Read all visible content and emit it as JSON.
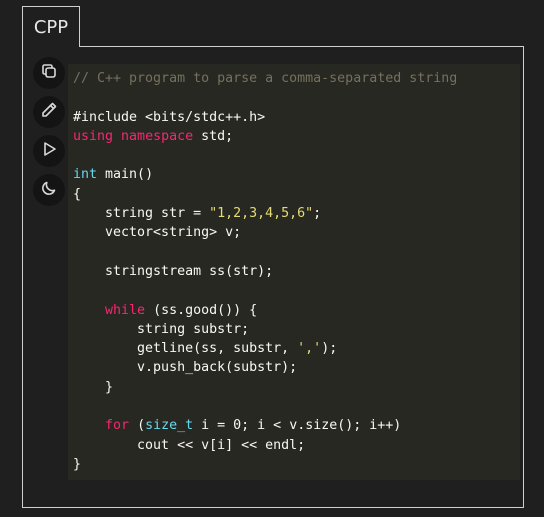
{
  "tab": {
    "label": "CPP"
  },
  "toolbar": {
    "icons": [
      {
        "name": "copy-icon"
      },
      {
        "name": "edit-icon"
      },
      {
        "name": "run-icon"
      },
      {
        "name": "dark-mode-icon"
      }
    ]
  },
  "colors": {
    "background": "#1f1f1f",
    "code_background": "#272822",
    "comment": "#75715e",
    "keyword": "#f92672",
    "type": "#66d9ef",
    "string": "#e6db74",
    "text": "#f8f8f2"
  },
  "code": {
    "language": "CPP",
    "lines": [
      [
        {
          "t": "comment",
          "v": "// C++ program to parse a comma-separated string"
        }
      ],
      [],
      [
        {
          "t": "plain",
          "v": "#include <bits/stdc++.h>"
        }
      ],
      [
        {
          "t": "keyword",
          "v": "using"
        },
        {
          "t": "plain",
          "v": " "
        },
        {
          "t": "keyword",
          "v": "namespace"
        },
        {
          "t": "plain",
          "v": " std;"
        }
      ],
      [],
      [
        {
          "t": "type",
          "v": "int"
        },
        {
          "t": "plain",
          "v": " main()"
        }
      ],
      [
        {
          "t": "plain",
          "v": "{"
        }
      ],
      [
        {
          "t": "plain",
          "v": "    string str = "
        },
        {
          "t": "string",
          "v": "\"1,2,3,4,5,6\""
        },
        {
          "t": "plain",
          "v": ";"
        }
      ],
      [
        {
          "t": "plain",
          "v": "    vector<string> v;"
        }
      ],
      [],
      [
        {
          "t": "plain",
          "v": "    stringstream ss(str);"
        }
      ],
      [],
      [
        {
          "t": "plain",
          "v": "    "
        },
        {
          "t": "keyword",
          "v": "while"
        },
        {
          "t": "plain",
          "v": " (ss.good()) {"
        }
      ],
      [
        {
          "t": "plain",
          "v": "        string substr;"
        }
      ],
      [
        {
          "t": "plain",
          "v": "        getline(ss, substr, "
        },
        {
          "t": "string",
          "v": "','"
        },
        {
          "t": "plain",
          "v": ");"
        }
      ],
      [
        {
          "t": "plain",
          "v": "        v.push_back(substr);"
        }
      ],
      [
        {
          "t": "plain",
          "v": "    }"
        }
      ],
      [],
      [
        {
          "t": "plain",
          "v": "    "
        },
        {
          "t": "keyword",
          "v": "for"
        },
        {
          "t": "plain",
          "v": " ("
        },
        {
          "t": "type",
          "v": "size_t"
        },
        {
          "t": "plain",
          "v": " i = 0; i < v.size(); i++)"
        }
      ],
      [
        {
          "t": "plain",
          "v": "        cout << v[i] << endl;"
        }
      ],
      [
        {
          "t": "plain",
          "v": "}"
        }
      ]
    ]
  }
}
